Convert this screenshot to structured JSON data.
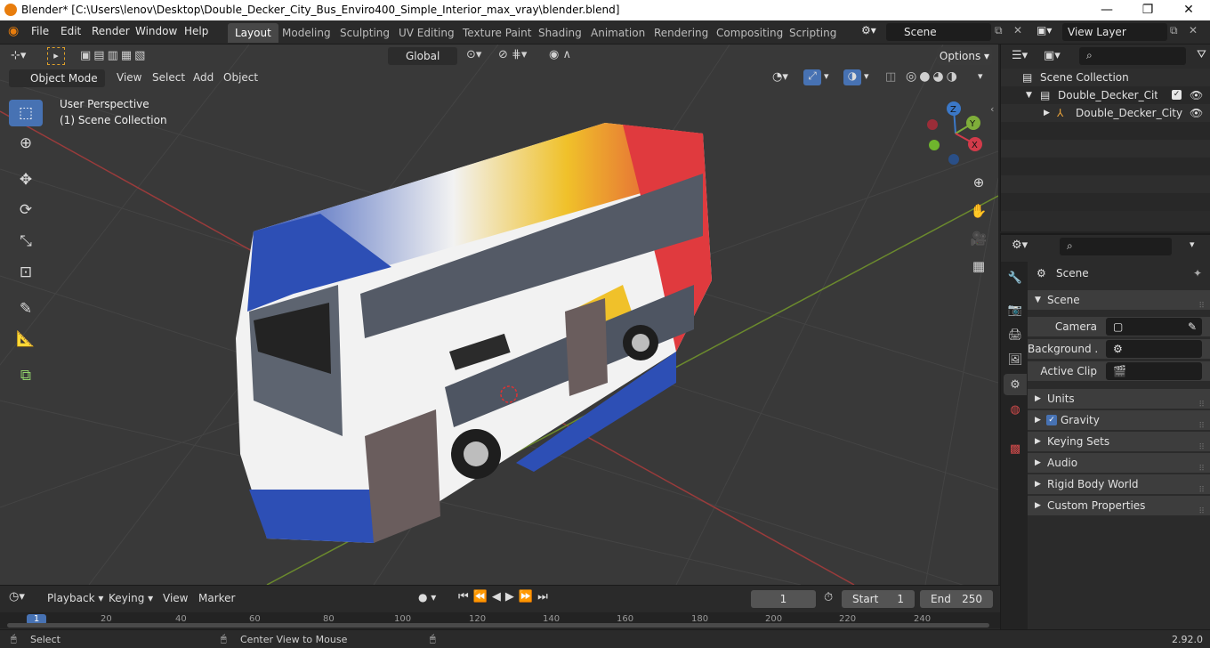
{
  "window": {
    "title": "Blender* [C:\\Users\\lenov\\Desktop\\Double_Decker_City_Bus_Enviro400_Simple_Interior_max_vray\\blender.blend]",
    "minimize": "—",
    "maximize": "❐",
    "close": "✕"
  },
  "menu": [
    "File",
    "Edit",
    "Render",
    "Window",
    "Help"
  ],
  "workspaces": [
    "Layout",
    "Modeling",
    "Sculpting",
    "UV Editing",
    "Texture Paint",
    "Shading",
    "Animation",
    "Rendering",
    "Compositing",
    "Scripting"
  ],
  "active_workspace": "Layout",
  "scene_field": "Scene",
  "view_layer_field": "View Layer",
  "header": {
    "transform_orientation": "Global",
    "options": "Options"
  },
  "viewport_header": {
    "mode": "Object Mode",
    "menus": [
      "View",
      "Select",
      "Add",
      "Object"
    ]
  },
  "viewport": {
    "perspective": "User Perspective",
    "collection": "(1) Scene Collection"
  },
  "gizmo": {
    "x": "X",
    "y": "Y",
    "z": "Z"
  },
  "outliner": {
    "root": "Scene Collection",
    "collection": "Double_Decker_City_Bus",
    "object": "Double_Decker_City"
  },
  "properties": {
    "context": "Scene",
    "panel": "Scene",
    "fields": [
      {
        "label": "Camera"
      },
      {
        "label": "Background ..."
      },
      {
        "label": "Active Clip"
      }
    ],
    "subpanels": [
      "Units",
      "Gravity",
      "Keying Sets",
      "Audio",
      "Rigid Body World",
      "Custom Properties"
    ],
    "gravity_checked": true
  },
  "timeline": {
    "menus": [
      "Playback",
      "Keying",
      "View",
      "Marker"
    ],
    "current_frame": "1",
    "start_label": "Start",
    "start": "1",
    "end_label": "End",
    "end": "250",
    "ruler": [
      "1",
      "20",
      "40",
      "60",
      "80",
      "100",
      "120",
      "140",
      "160",
      "180",
      "200",
      "220",
      "240"
    ]
  },
  "statusbar": {
    "left": "Select",
    "middle": "Center View to Mouse",
    "version": "2.92.0"
  },
  "colors": {
    "accent": "#4772b3",
    "bus_red": "#e03a3e",
    "bus_blue": "#2d4fb5",
    "bus_yellow": "#f0c12a"
  }
}
